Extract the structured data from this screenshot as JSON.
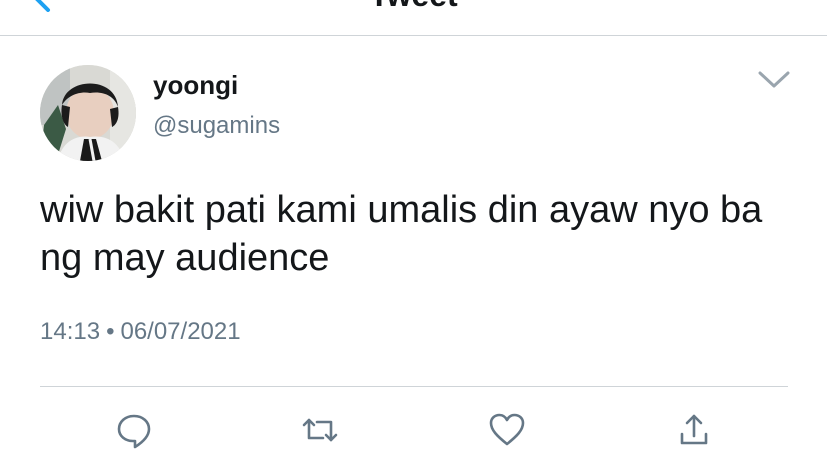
{
  "nav": {
    "title": "Tweet",
    "back_icon": "chevron-left-icon"
  },
  "tweet": {
    "author": {
      "name": "yoongi",
      "handle": "@sugamins"
    },
    "text": "wiw bakit pati kami umalis din ayaw nyo ba ng may audience",
    "time": "14:13",
    "separator": "•",
    "date": "06/07/2021"
  },
  "actions": [
    {
      "name": "reply",
      "icon": "reply-icon"
    },
    {
      "name": "retweet",
      "icon": "retweet-icon"
    },
    {
      "name": "like",
      "icon": "heart-icon"
    },
    {
      "name": "share",
      "icon": "share-icon"
    }
  ],
  "colors": {
    "accent": "#1da1f2",
    "muted": "#657786",
    "text": "#14171a",
    "icon": "#657786",
    "divider": "#cfd4d8"
  }
}
